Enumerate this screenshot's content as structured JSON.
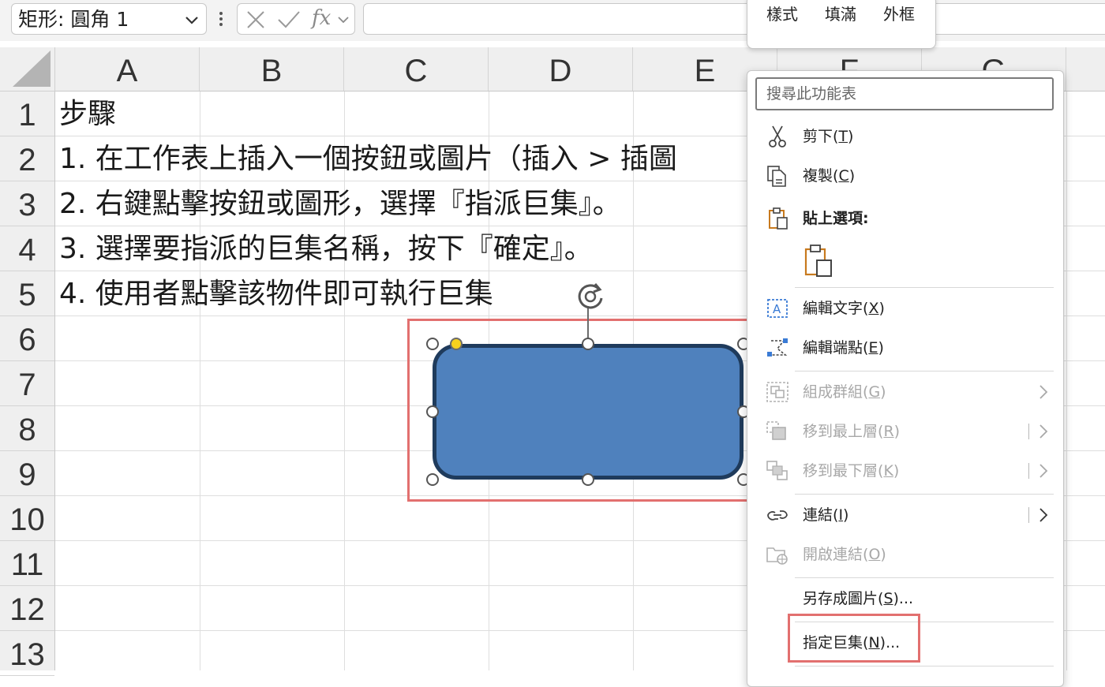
{
  "formula_bar": {
    "name_box": "矩形:  圓角 1",
    "fx_label": "fx",
    "formula_value": ""
  },
  "sheet": {
    "columns": [
      "A",
      "B",
      "C",
      "D",
      "E",
      "F",
      "G"
    ],
    "rows": [
      "1",
      "2",
      "3",
      "4",
      "5",
      "6",
      "7",
      "8",
      "9",
      "10",
      "11",
      "12",
      "13"
    ],
    "cells": {
      "A1": "步驟",
      "A2": "1. 在工作表上插入一個按鈕或圖片（插入 > 插圖",
      "A3": "2. 右鍵點擊按鈕或圖形，選擇『指派巨集』。",
      "A4": "3. 選擇要指派的巨集名稱，按下『確定』。",
      "A5": "4. 使用者點擊該物件即可執行巨集"
    }
  },
  "shape": {
    "fill_color": "#4f81bd",
    "border_color": "#1f3b5c",
    "highlight_color": "#e2706f"
  },
  "mini_toolbar": {
    "buttons": [
      "樣式",
      "填滿",
      "外框"
    ]
  },
  "context_menu": {
    "search_placeholder": "搜尋此功能表",
    "paste_options_label": "貼上選項:",
    "items": [
      {
        "label": "剪下",
        "key": "T",
        "icon": "scissors-icon",
        "disabled": false
      },
      {
        "label": "複製",
        "key": "C",
        "icon": "copy-icon",
        "disabled": false
      },
      {
        "label": "編輯文字",
        "key": "X",
        "icon": "edit-text-icon",
        "disabled": false
      },
      {
        "label": "編輯端點",
        "key": "E",
        "icon": "edit-points-icon",
        "disabled": false
      },
      {
        "label": "組成群組",
        "key": "G",
        "icon": "group-icon",
        "disabled": true
      },
      {
        "label": "移到最上層",
        "key": "R",
        "icon": "bring-to-front-icon",
        "disabled": true
      },
      {
        "label": "移到最下層",
        "key": "K",
        "icon": "send-to-back-icon",
        "disabled": true
      },
      {
        "label": "連結",
        "key": "I",
        "icon": "link-icon",
        "disabled": false
      },
      {
        "label": "開啟連結",
        "key": "O",
        "icon": "open-link-icon",
        "disabled": true
      },
      {
        "label": "另存成圖片",
        "key": "S",
        "suffix": "...",
        "icon": "",
        "disabled": false
      },
      {
        "label": "指定巨集",
        "key": "N",
        "suffix": "...",
        "icon": "",
        "disabled": false
      }
    ]
  }
}
